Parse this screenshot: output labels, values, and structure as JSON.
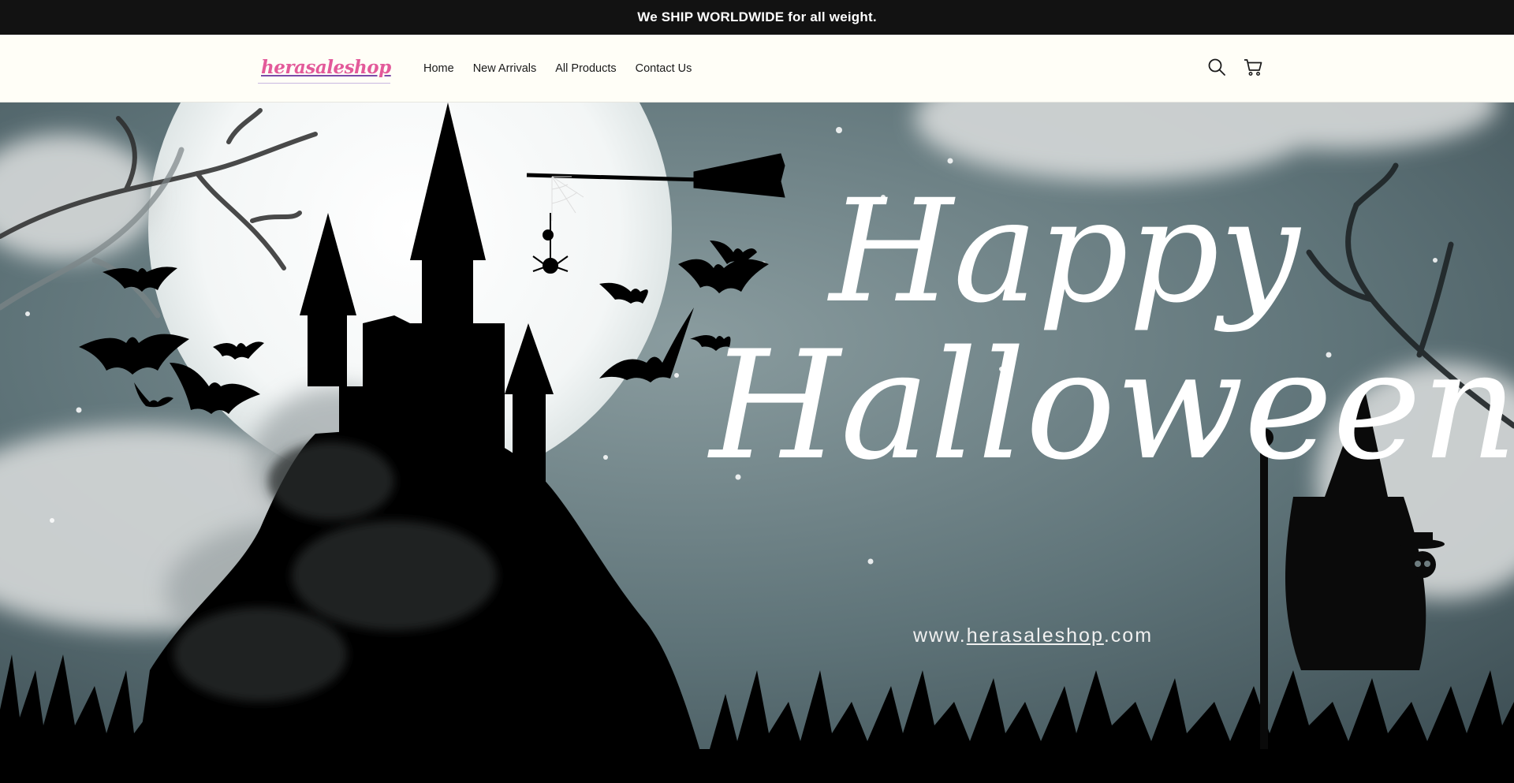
{
  "announcement": {
    "text": "We SHIP WORLDWIDE for all weight."
  },
  "brand": {
    "logo_text": "herasaleshop"
  },
  "nav": {
    "items": [
      {
        "label": "Home"
      },
      {
        "label": "New Arrivals"
      },
      {
        "label": "All Products"
      },
      {
        "label": "Contact Us"
      }
    ]
  },
  "icons": {
    "search": "search-icon",
    "cart": "cart-icon"
  },
  "hero": {
    "title_line1": "Happy",
    "title_line2": "Halloween",
    "url_prefix": "www.",
    "url_domain": "herasaleshop",
    "url_suffix": ".com"
  },
  "colors": {
    "announcement_bg": "#121212",
    "header_bg": "#fffef7",
    "sky": "#5e7378",
    "moon": "#f5f7f7",
    "logo_pink": "#e35a9a"
  }
}
